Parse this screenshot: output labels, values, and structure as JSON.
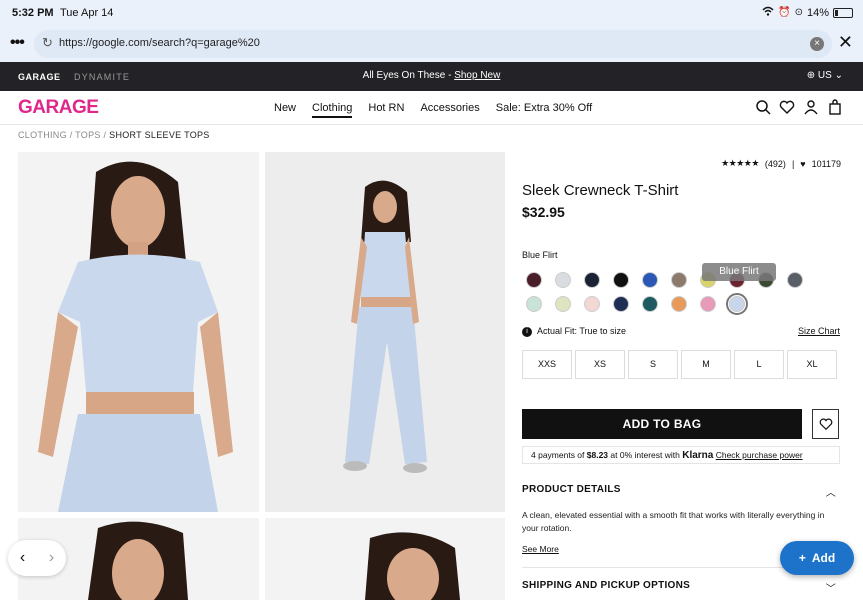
{
  "status_bar": {
    "time": "5:32 PM",
    "day": "Tue Apr 14",
    "battery": "14%"
  },
  "browser": {
    "url": "https://google.com/search?q=garage%20"
  },
  "promo_bar": {
    "brand_primary": "GARAGE",
    "brand_secondary": "DYNAMITE",
    "message": "All Eyes On These - ",
    "link": "Shop New",
    "locale": "US"
  },
  "nav": {
    "logo": "GARAGE",
    "links": [
      "New",
      "Clothing",
      "Hot RN",
      "Accessories",
      "Sale: Extra 30% Off"
    ],
    "active": "Clothing"
  },
  "breadcrumb": [
    "CLOTHING",
    "TOPS",
    "SHORT SLEEVE TOPS"
  ],
  "product": {
    "rating_stars": "★★★★★",
    "review_count": "(492)",
    "wishlist_count": "101179",
    "title": "Sleek Crewneck T-Shirt",
    "price": "$32.95",
    "selected_color": "Blue Flirt",
    "tooltip": "Blue Flirt",
    "swatch_colors": [
      "#4a1f2a",
      "#d9dde2",
      "#1c2236",
      "#111111",
      "#2b58b5",
      "#8c7a6c",
      "#d8d46a",
      "#6b2330",
      "#3b4a33",
      "#5a5e66",
      "#c9e3d9",
      "#dde5c0",
      "#f2d7d2",
      "#1f2e55",
      "#1d5a61",
      "#e79a5c",
      "#e79bb8",
      "#c7d6ea"
    ],
    "fit_label": "Actual Fit: True to size",
    "size_chart": "Size Chart",
    "sizes": [
      "XXS",
      "XS",
      "S",
      "M",
      "L",
      "XL"
    ],
    "add_to_bag": "ADD TO BAG",
    "klarna": {
      "prefix": "4 payments of ",
      "amount": "$8.23",
      "middle": " at 0% interest with ",
      "brand": "Klarna",
      "link": "Check purchase power"
    },
    "details_heading": "PRODUCT DETAILS",
    "description": "A clean, elevated essential with a smooth fit that works with literally everything in your rotation.",
    "see_more": "See More",
    "shipping_heading": "SHIPPING AND PICKUP OPTIONS"
  },
  "fab": {
    "label": "Add"
  }
}
